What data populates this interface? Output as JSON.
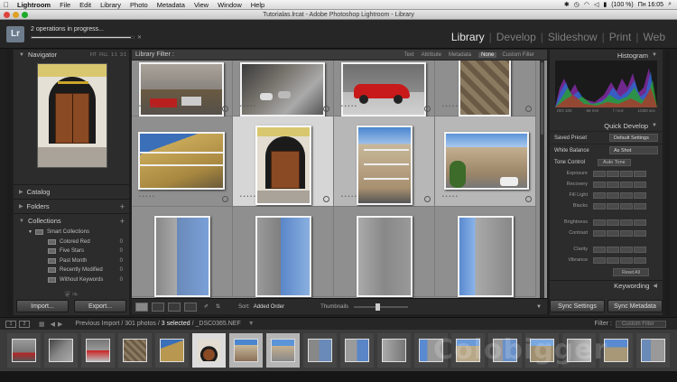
{
  "menubar": {
    "items": [
      "Lightroom",
      "File",
      "Edit",
      "Library",
      "Photo",
      "Metadata",
      "View",
      "Window",
      "Help"
    ],
    "status": {
      "battery": "(100 %)",
      "clock": "Пн 16:05"
    }
  },
  "titlebar": {
    "title": "Tutorialas.lrcat - Adobe Photoshop Lightroom - Library"
  },
  "header": {
    "logo": "Lr",
    "progress_label": "2 operations in progress...",
    "progress": 0.97,
    "modules": [
      "Library",
      "Develop",
      "Slideshow",
      "Print",
      "Web"
    ],
    "active_module": "Library",
    "separator": "|"
  },
  "left_panel": {
    "navigator": {
      "title": "Navigator",
      "options": [
        "FIT",
        "FILL",
        "1:1",
        "3:1"
      ]
    },
    "sections": [
      "Catalog",
      "Folders",
      "Collections"
    ],
    "plus": "+",
    "smart_collections": {
      "title": "Smart Collections",
      "items": [
        {
          "label": "Colored Red",
          "count": "0"
        },
        {
          "label": "Five Stars",
          "count": "0"
        },
        {
          "label": "Past Month",
          "count": "0"
        },
        {
          "label": "Recently Modified",
          "count": "0"
        },
        {
          "label": "Without Keywords",
          "count": "0"
        }
      ]
    },
    "import_label": "Import...",
    "export_label": "Export..."
  },
  "filter_bar": {
    "title": "Library Filter :",
    "options": [
      "Text",
      "Attribute",
      "Metadata",
      "None"
    ],
    "selected": "None",
    "custom": "Custom Filter"
  },
  "toolbar": {
    "sort_label": "Sort:",
    "sort_value": "Added Order",
    "thumbnails_label": "Thumbnails",
    "thumb_size": 0.4
  },
  "right_panel": {
    "histogram_title": "Histogram",
    "histogram_info": [
      "ISO 100",
      "66 mm",
      "f / 8.0",
      "1/200 sec"
    ],
    "quick_develop_title": "Quick Develop",
    "saved_preset": {
      "label": "Saved Preset",
      "value": "Default Settings"
    },
    "white_balance": {
      "label": "White Balance",
      "value": "As Shot"
    },
    "tone_control": {
      "label": "Tone Control",
      "auto": "Auto Tone"
    },
    "adjustments": [
      "Exposure",
      "Recovery",
      "Fill Light",
      "Blacks",
      "Brightness",
      "Contrast",
      "Clarity",
      "Vibrance"
    ],
    "reset": "Reset All",
    "keywording_title": "Keywording",
    "sync_settings": "Sync Settings",
    "sync_metadata": "Sync Metadata"
  },
  "filmstrip_bar": {
    "path": "Previous Import / 301 photos /",
    "selected": "3 selected",
    "file": "/ _DSC0365.NEF",
    "filter_label": "Filter :",
    "filter_value": "Custom Filter"
  },
  "watermark": "Colobigger"
}
